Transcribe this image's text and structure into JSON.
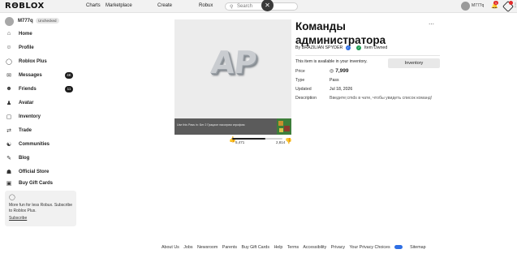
{
  "topbar": {
    "logo": "RΘBLOX",
    "nav": [
      "Charts",
      "Marketplace",
      "Create",
      "Robux"
    ],
    "search_placeholder": "Search",
    "username": "M777q",
    "bell_badge": "1"
  },
  "sidebar": {
    "username": "M777q",
    "badge": "Unchecked",
    "items": [
      {
        "label": "Home",
        "icon": "home-icon"
      },
      {
        "label": "Profile",
        "icon": "profile-icon"
      },
      {
        "label": "Roblox Plus",
        "icon": "roblox-plus-icon"
      },
      {
        "label": "Messages",
        "icon": "messages-icon",
        "count": "4K"
      },
      {
        "label": "Friends",
        "icon": "friends-icon",
        "count": "11"
      },
      {
        "label": "Avatar",
        "icon": "avatar-icon"
      },
      {
        "label": "Inventory",
        "icon": "inventory-icon"
      },
      {
        "label": "Trade",
        "icon": "trade-icon"
      },
      {
        "label": "Communities",
        "icon": "communities-icon"
      },
      {
        "label": "Blog",
        "icon": "blog-icon"
      },
      {
        "label": "Official Store",
        "icon": "store-icon"
      },
      {
        "label": "Buy Gift Cards",
        "icon": "gift-card-icon"
      }
    ],
    "premium": {
      "text": "More fun for less Robux. Subscribe to Roblox Plus.",
      "link": "Subscribe"
    }
  },
  "item": {
    "thumbnail_text": "AP",
    "banner_text": "Use this Pass in: Бег 2 Грацион пасогрим игрофом",
    "title": "Команды администратора",
    "creator_prefix": "By",
    "creator": "BRAZILIAN SPYDER",
    "owned_label": "Item Owned",
    "availability": "This item is available in your inventory.",
    "inventory_button": "Inventory",
    "votes": {
      "up": "5,471",
      "down": "2,814",
      "up_fraction": 0.66
    },
    "details": [
      {
        "label": "Price",
        "value": "7,999"
      },
      {
        "label": "Type",
        "value": "Pass"
      },
      {
        "label": "Updated",
        "value": "Jul 18, 2026"
      },
      {
        "label": "Description",
        "value": "Введите;cmds в чате, чтобы увидеть список команд!"
      }
    ]
  },
  "footer": {
    "links": [
      "About Us",
      "Jobs",
      "Newsroom",
      "Parents",
      "Buy Gift Cards",
      "Help",
      "Terms",
      "Accessibility",
      "Privacy",
      "Your Privacy Choices",
      "Sitemap"
    ]
  }
}
